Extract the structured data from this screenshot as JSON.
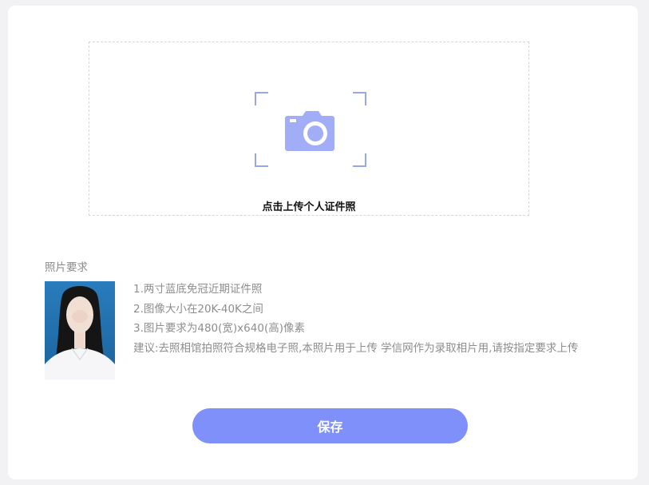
{
  "upload": {
    "label": "点击上传个人证件照",
    "icon": "camera-icon",
    "icon_color": "#a2adf8",
    "frame_color": "#9aa6ec"
  },
  "requirements": {
    "title": "照片要求",
    "items": [
      "1.两寸蓝底免冠近期证件照",
      "2.图像大小在20K-40K之间",
      "3.图片要求为480(宽)x640(高)像素",
      "建议:去照相馆拍照符合规格电子照,本照片用于上传 学信网作为录取相片用,请按指定要求上传"
    ],
    "sample_photo_bg": "#1f6fae"
  },
  "actions": {
    "save_label": "保存",
    "save_color": "#7f90fb"
  }
}
